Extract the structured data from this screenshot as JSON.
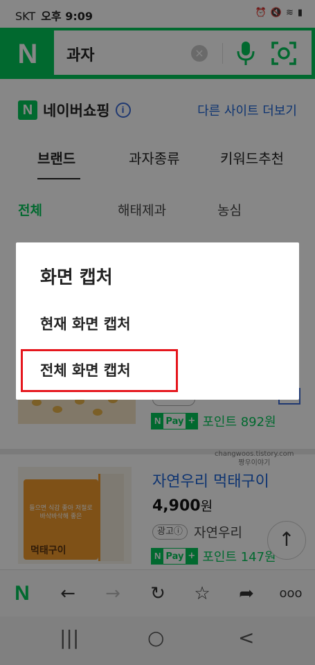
{
  "status_bar": {
    "carrier": "SKT",
    "time": "오후 9:09",
    "icons": [
      "alarm-icon",
      "mute-icon",
      "volte-icon",
      "wifi-icon",
      "signal-icon"
    ]
  },
  "search": {
    "logo": "N",
    "query": "과자",
    "clear_icon": "×",
    "colors": {
      "brand": "#03c75a"
    }
  },
  "shopping": {
    "logo": "N",
    "title": "네이버쇼핑",
    "info_icon": "i",
    "other_sites_link": "다른 사이트 더보기"
  },
  "tabs": [
    {
      "label": "브랜드",
      "active": true
    },
    {
      "label": "과자종류",
      "active": false
    },
    {
      "label": "키워드추천",
      "active": false
    }
  ],
  "subtabs": [
    {
      "label": "전체",
      "active": true
    },
    {
      "label": "해태제과",
      "active": false
    },
    {
      "label": "농심",
      "active": false
    }
  ],
  "product1": {
    "pay_n": "N",
    "pay_label": "Pay",
    "pay_plus": "+",
    "points": "포인트 892원"
  },
  "watermark": {
    "line1": "changwoos.tistory.com",
    "line2": "짱우이야기"
  },
  "product2": {
    "title": "자연우리 먹태구이",
    "price_number": "4,900",
    "price_unit": "원",
    "ad_badge": "광고ⓘ",
    "seller": "자연우리",
    "pay_n": "N",
    "pay_label": "Pay",
    "pay_plus": "+",
    "points": "포인트 147원",
    "package_text": "들으면 식감 좋아 저절로 바삭바삭해 좋은",
    "package_name": "먹태구이"
  },
  "scroll_top_icon": "↑",
  "toolbar": {
    "home": "N",
    "back": "←",
    "forward": "→",
    "refresh": "↻",
    "bookmark": "☆",
    "share": "➦",
    "more": "ooo"
  },
  "android_nav": {
    "recents": "|||",
    "home": "○",
    "back": "<"
  },
  "dialog": {
    "title": "화면 캡처",
    "options": [
      "현재 화면 캡처",
      "전체 화면 캡처"
    ],
    "highlight_color": "#e5161d"
  }
}
